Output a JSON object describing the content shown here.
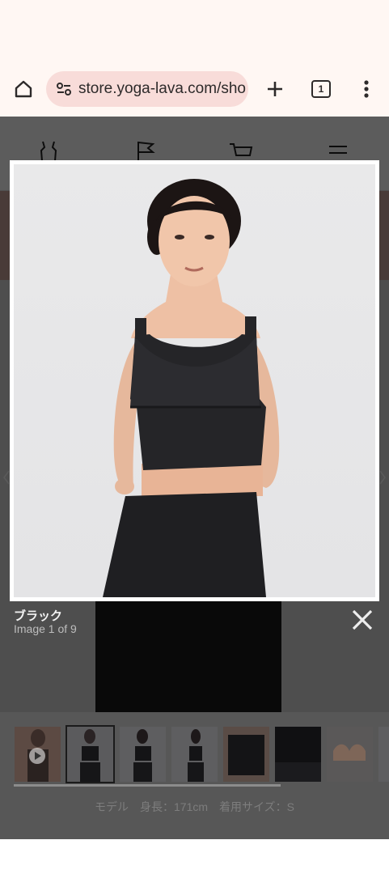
{
  "browser": {
    "url": "store.yoga-lava.com/sho",
    "tab_count": "1"
  },
  "site_nav": {
    "icons": [
      "tank-top-icon",
      "flag-icon",
      "cart-icon",
      "hamburger-menu-icon"
    ]
  },
  "lightbox": {
    "color_name": "ブラック",
    "image_counter": "Image 1 of 9"
  },
  "thumbnails": [
    {
      "name": "video-thumbnail",
      "label": "play"
    },
    {
      "name": "front-view"
    },
    {
      "name": "back-view"
    },
    {
      "name": "side-view"
    },
    {
      "name": "detail-front"
    },
    {
      "name": "detail-fabric"
    },
    {
      "name": "inner-bra"
    },
    {
      "name": "partial"
    }
  ],
  "model_info": "モデル　身長：171cm　着用サイズ：S",
  "colors": {
    "browser_bg": "#fff7f3",
    "url_pill": "#f8dcd9",
    "overlay": "rgba(0,0,0,0.64)"
  }
}
